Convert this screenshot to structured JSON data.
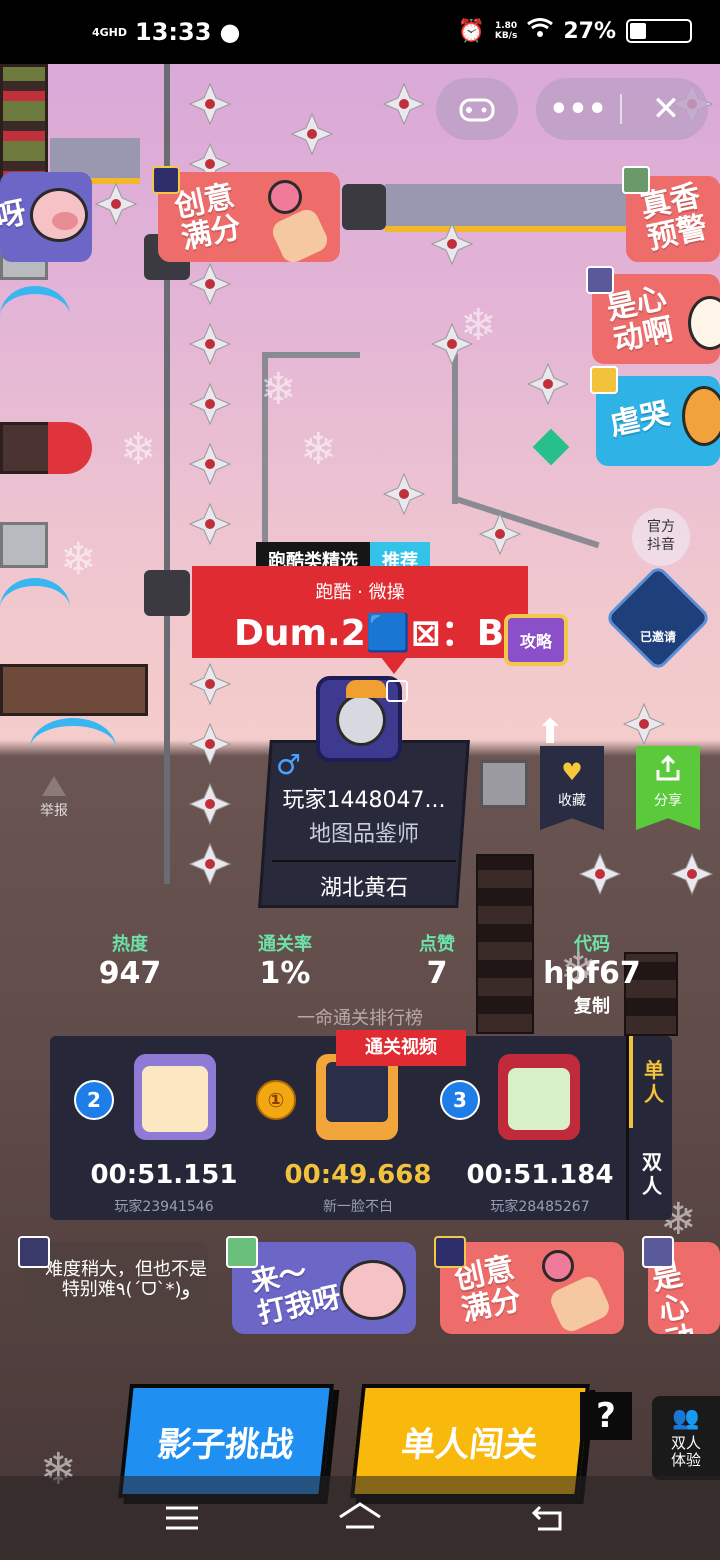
{
  "status_bar": {
    "network": "4GHD",
    "time": "13:33",
    "speed": "1.80\nKB/s",
    "battery": "27%",
    "battery_level": 0.27
  },
  "top_controls": {
    "gamepad_icon": "gamepad-icon",
    "more_icon": "more-icon",
    "close_icon": "close-icon"
  },
  "stickers": {
    "creative_full": "创意\n满分",
    "real_fragrance": "真香\n预警",
    "heart_moved": "是心\n动啊",
    "cry": "虐哭",
    "pig_partial": "呀"
  },
  "official_douyin": "官方\n抖音",
  "invited_badge": "已邀请",
  "category_tag": {
    "category": "跑酷类精选",
    "recommend": "推荐"
  },
  "map": {
    "type": "跑酷 · 微操",
    "title": "Dum.2🟦⊠：Bl",
    "guide": "攻略"
  },
  "author": {
    "name": "玩家1448047...",
    "title": "地图品鉴师",
    "location": "湖北黄石",
    "gender_icon": "male-icon"
  },
  "actions": {
    "favorite": "收藏",
    "share": "分享",
    "report": "举报"
  },
  "stats": {
    "heat_label": "热度",
    "heat_value": "947",
    "clear_rate_label": "通关率",
    "clear_rate_value": "1%",
    "likes_label": "点赞",
    "likes_value": "7",
    "code_label": "代码",
    "code_value": "hpf67",
    "copy_label": "复制"
  },
  "leaderboard": {
    "title": "一命通关排行榜",
    "video_tag": "通关视频",
    "entries": [
      {
        "rank": "2",
        "time": "00:51.151",
        "player": "玩家23941546",
        "avatar_color": "#8f7bd6"
      },
      {
        "rank": "①",
        "time": "00:49.668",
        "player": "新一脸不白",
        "avatar_color": "#f2a53a"
      },
      {
        "rank": "3",
        "time": "00:51.184",
        "player": "玩家28485267",
        "avatar_color": "#c02a3a"
      }
    ],
    "mode_single": "单\n人",
    "mode_double": "双\n人"
  },
  "comments": {
    "comment_text": "难度稍大，但也不是特别难٩(ˊᗜˋ*)و",
    "pig_sticker": "来～\n打我呀",
    "creative_sticker": "创意\n满分",
    "heart_sticker": "是心\n动啊"
  },
  "buttons": {
    "shadow_challenge": "影子挑战",
    "solo_play": "单人闯关",
    "help": "?",
    "duo_experience": "双人\n体验"
  },
  "nav": {
    "menu_icon": "menu-icon",
    "home_icon": "home-icon",
    "back_icon": "back-icon"
  }
}
